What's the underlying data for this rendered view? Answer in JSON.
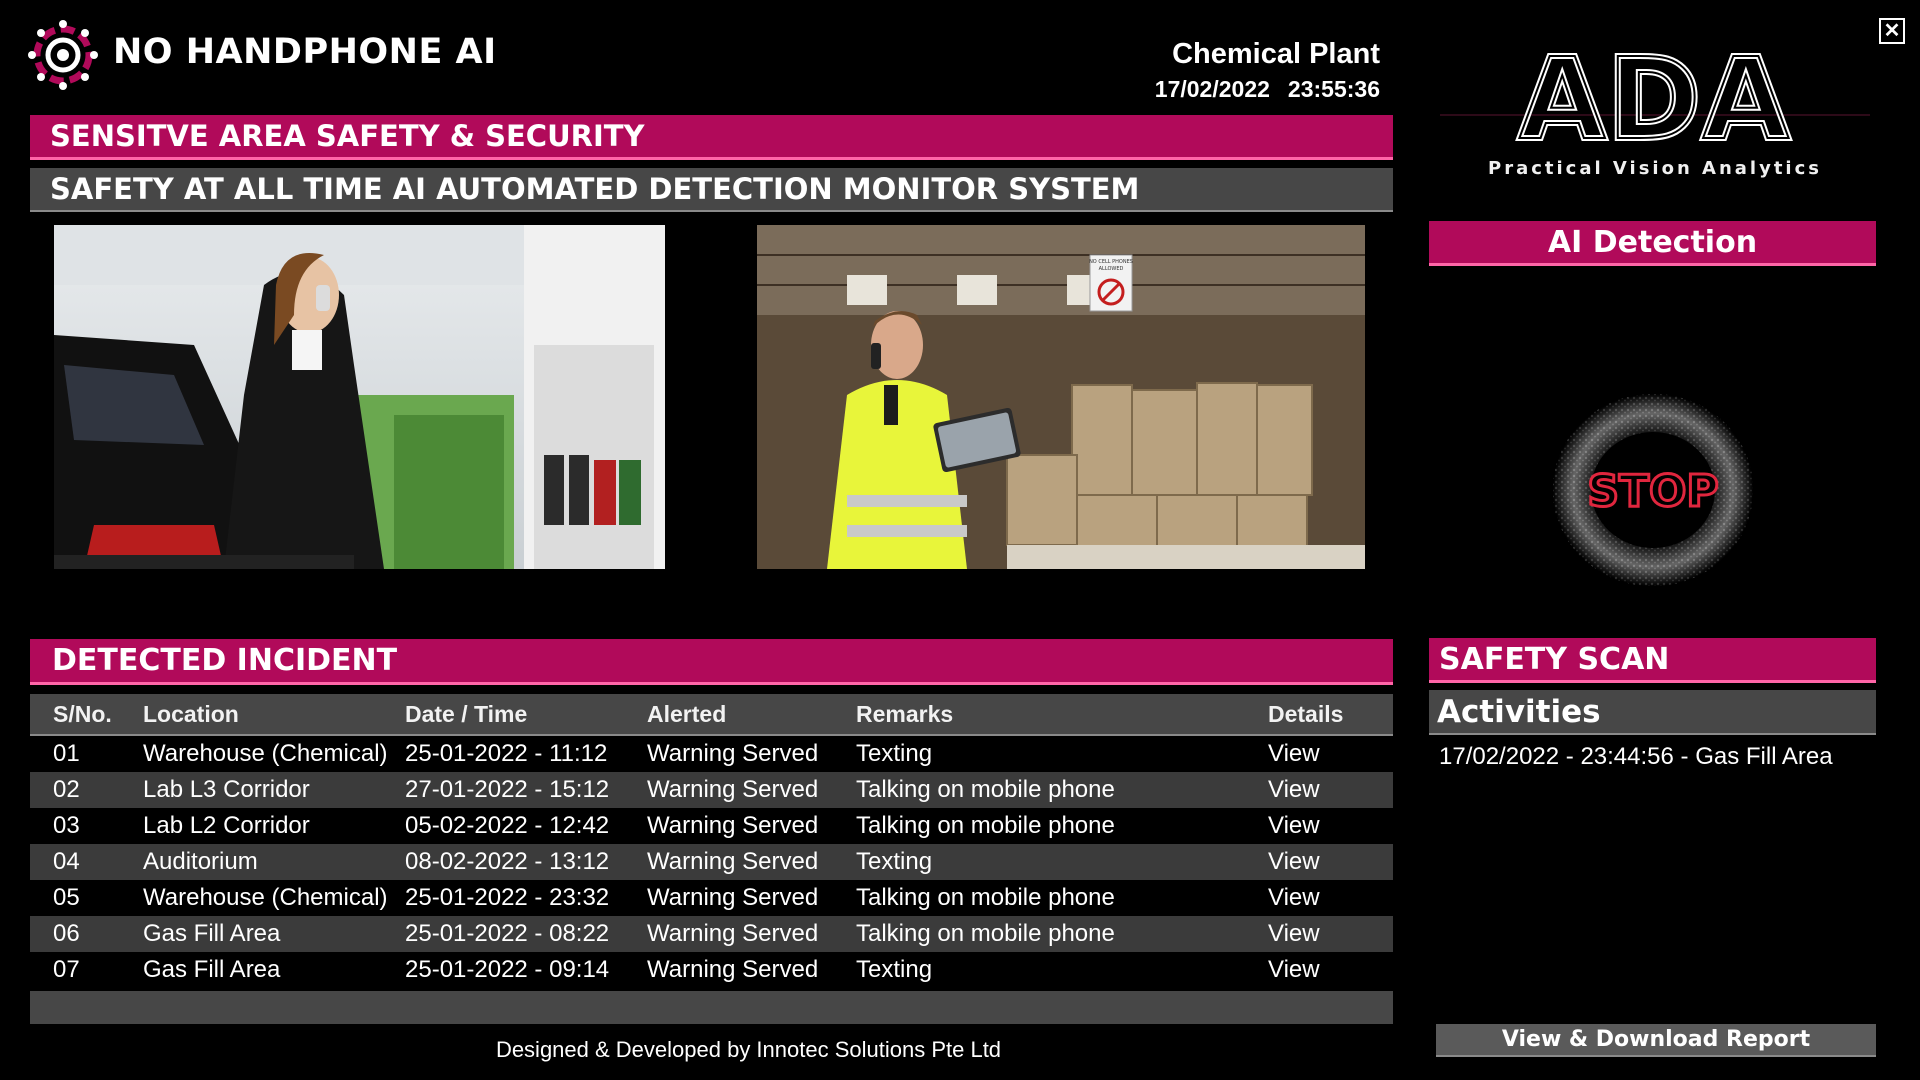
{
  "header": {
    "app_title": "NO HANDPHONE AI",
    "site_name": "Chemical Plant",
    "date": "17/02/2022",
    "time": "23:55:36",
    "logo_icon": "eye-target-icon"
  },
  "banners": {
    "primary": "SENSITVE AREA SAFETY & SECURITY",
    "secondary": "SAFETY AT ALL TIME AI AUTOMATED DETECTION MONITOR SYSTEM"
  },
  "cameras": [
    {
      "name": "camera-feed-gas-station"
    },
    {
      "name": "camera-feed-warehouse",
      "sign_text": [
        "NO CELL PHONES",
        "ALLOWED"
      ]
    }
  ],
  "incidents": {
    "title": "DETECTED INCIDENT",
    "columns": [
      "S/No.",
      "Location",
      "Date / Time",
      "Alerted",
      "Remarks",
      "Details"
    ],
    "rows": [
      [
        "01",
        "Warehouse (Chemical)",
        "25-01-2022 - 11:12",
        "Warning Served",
        "Texting",
        "View"
      ],
      [
        "02",
        "Lab L3 Corridor",
        "27-01-2022 - 15:12",
        "Warning Served",
        "Talking on mobile phone",
        "View"
      ],
      [
        "03",
        "Lab L2 Corridor",
        "05-02-2022 - 12:42",
        "Warning Served",
        "Talking on mobile phone",
        "View"
      ],
      [
        "04",
        "Auditorium",
        "08-02-2022 - 13:12",
        "Warning Served",
        "Texting",
        "View"
      ],
      [
        "05",
        "Warehouse (Chemical)",
        "25-01-2022 - 23:32",
        "Warning Served",
        "Talking on mobile phone",
        "View"
      ],
      [
        "06",
        "Gas Fill Area",
        "25-01-2022 - 08:22",
        "Warning Served",
        "Talking on mobile phone",
        "View"
      ],
      [
        "07",
        "Gas Fill Area",
        "25-01-2022 - 09:14",
        "Warning Served",
        "Texting",
        "View"
      ]
    ]
  },
  "footer": {
    "credit": "Designed & Developed by Innotec Solutions Pte Ltd"
  },
  "right_panel": {
    "brand": "ADA",
    "tagline": "Practical Vision Analytics",
    "ai_detection_title": "AI Detection",
    "stop_label": "STOP",
    "safety_scan_title": "SAFETY SCAN",
    "activities_title": "Activities",
    "activities": [
      "17/02/2022 - 23:44:56 - Gas Fill Area"
    ],
    "report_button": "View & Download Report",
    "close_icon": "close-icon"
  },
  "colors": {
    "accent_magenta": "#b10a5a",
    "bar_grey": "#474747",
    "background": "#000000"
  }
}
